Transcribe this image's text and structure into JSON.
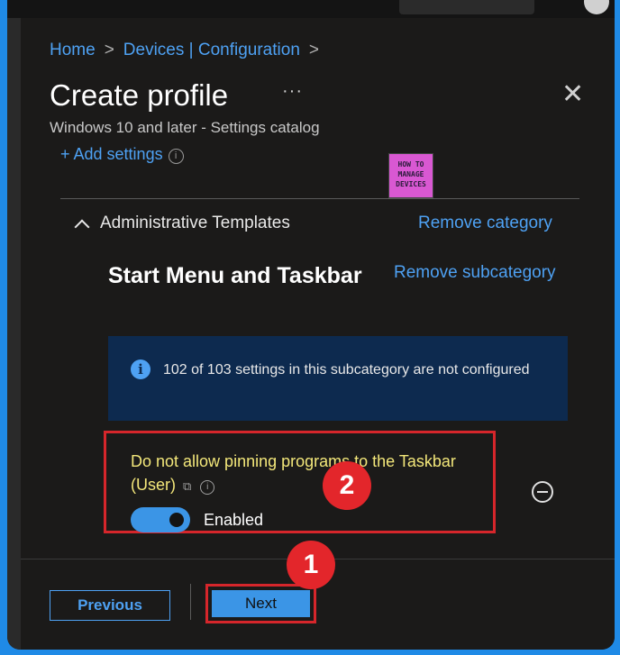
{
  "breadcrumb": {
    "home": "Home",
    "sep1": ">",
    "devices": "Devices | Configuration",
    "sep2": ">"
  },
  "header": {
    "title": "Create profile",
    "more": "···",
    "close": "✕",
    "subtitle": "Windows 10 and later - Settings catalog"
  },
  "add_settings": {
    "label": "+ Add settings",
    "info": "i"
  },
  "logo": {
    "line1": "HOW TO",
    "line2": "MANAGE",
    "line3": "DEVICES"
  },
  "category": {
    "name": "Administrative Templates",
    "remove": "Remove category"
  },
  "subcategory": {
    "name": "Start Menu and Taskbar",
    "remove": "Remove subcategory"
  },
  "info": {
    "icon": "i",
    "text": "102 of 103 settings in this subcategory are not configured"
  },
  "setting": {
    "name": "Do not allow pinning programs to the Taskbar (User)",
    "toggle_label": "Enabled",
    "enabled": true,
    "info": "i"
  },
  "badges": {
    "one": "1",
    "two": "2"
  },
  "footer": {
    "previous": "Previous",
    "next": "Next"
  },
  "colors": {
    "accent": "#4ea1f3",
    "highlight": "#d6262b",
    "background": "#1b1a19"
  }
}
